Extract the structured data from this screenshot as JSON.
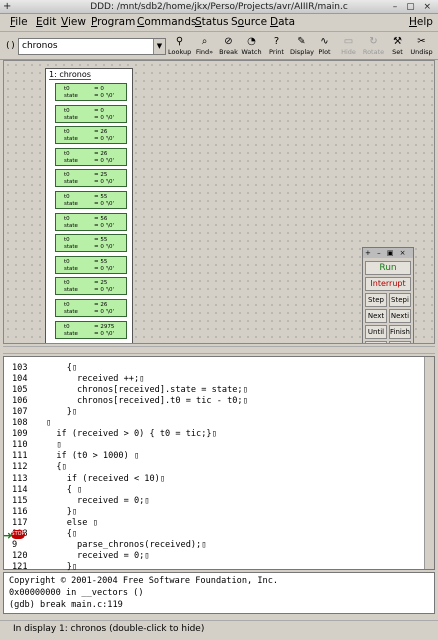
{
  "window": {
    "title": "DDD: /mnt/sdb2/home/jkx/Perso/Projects/avr/AIIIR/main.c"
  },
  "menu": [
    {
      "label": "File",
      "ul": "F"
    },
    {
      "label": "Edit",
      "ul": "E"
    },
    {
      "label": "View",
      "ul": "V"
    },
    {
      "label": "Program",
      "ul": "P"
    },
    {
      "label": "Commands",
      "ul": "C"
    },
    {
      "label": "Status",
      "ul": "S"
    },
    {
      "label": "Source",
      "ul": "o"
    },
    {
      "label": "Data",
      "ul": "D"
    },
    {
      "label": "Help",
      "ul": "H"
    }
  ],
  "toolbar": {
    "arg_label": "():",
    "arg_value": "chronos",
    "buttons": [
      {
        "label": "Lookup",
        "icon": "lookup-icon",
        "glyph": "⚲"
      },
      {
        "label": "Find»",
        "icon": "find-icon",
        "glyph": "⌕"
      },
      {
        "label": "Break",
        "icon": "break-icon",
        "glyph": "⊘"
      },
      {
        "label": "Watch",
        "icon": "watch-icon",
        "glyph": "◔"
      },
      {
        "label": "Print",
        "icon": "print-icon",
        "glyph": "?"
      },
      {
        "label": "Display",
        "icon": "display-icon",
        "glyph": "✎"
      },
      {
        "label": "Plot",
        "icon": "plot-icon",
        "glyph": "∿"
      },
      {
        "label": "Hide",
        "icon": "hide-icon",
        "glyph": "▭",
        "disabled": true
      },
      {
        "label": "Rotate",
        "icon": "rotate-icon",
        "glyph": "↻",
        "disabled": true
      },
      {
        "label": "Set",
        "icon": "set-icon",
        "glyph": "⚒"
      },
      {
        "label": "Undisp",
        "icon": "undisp-icon",
        "glyph": "✂"
      }
    ]
  },
  "display": {
    "title": "1: chronos",
    "rows": [
      {
        "t0": "= 0",
        "state": "= 0 '\\0'"
      },
      {
        "t0": "= 0",
        "state": "= 0 '\\0'"
      },
      {
        "t0": "= 26",
        "state": "= 0 '\\0'"
      },
      {
        "t0": "= 26",
        "state": "= 0 '\\0'"
      },
      {
        "t0": "= 25",
        "state": "= 0 '\\0'"
      },
      {
        "t0": "= 55",
        "state": "= 0 '\\0'"
      },
      {
        "t0": "= 56",
        "state": "= 0 '\\0'"
      },
      {
        "t0": "= 55",
        "state": "= 0 '\\0'"
      },
      {
        "t0": "= 55",
        "state": "= 0 '\\0'"
      },
      {
        "t0": "= 25",
        "state": "= 0 '\\0'"
      },
      {
        "t0": "= 26",
        "state": "= 0 '\\0'"
      },
      {
        "t0": "= 2975",
        "state": "= 0 '\\0'"
      }
    ],
    "field1": "t0",
    "field2": "state"
  },
  "command_tool": {
    "run": "Run",
    "interrupt": "Interrupt",
    "run_color": "#1a7a1a",
    "interrupt_color": "#b00000",
    "buttons": [
      [
        "Step",
        "Stepi"
      ],
      [
        "Next",
        "Nexti"
      ],
      [
        "Until",
        "Finish"
      ],
      [
        "Cont",
        "Kill"
      ],
      [
        "Up",
        "Down"
      ],
      [
        "Undo",
        "Redo"
      ],
      [
        "Edit",
        "Make"
      ]
    ]
  },
  "source": {
    "lines": [
      {
        "n": "103",
        "code": "    {▯"
      },
      {
        "n": "104",
        "code": "      received ++;▯"
      },
      {
        "n": "105",
        "code": "      chronos[received].state = state;▯"
      },
      {
        "n": "106",
        "code": "      chronos[received].t0 = tic - t0;▯"
      },
      {
        "n": "107",
        "code": "    }▯"
      },
      {
        "n": "108",
        "code": "▯"
      },
      {
        "n": "109",
        "code": "  if (received > 0) { t0 = tic;}▯"
      },
      {
        "n": "110",
        "code": "  ▯"
      },
      {
        "n": "111",
        "code": "  if (t0 > 1000) ▯"
      },
      {
        "n": "112",
        "code": "  {▯"
      },
      {
        "n": "113",
        "code": "    if (received < 10)▯"
      },
      {
        "n": "114",
        "code": "    { ▯"
      },
      {
        "n": "115",
        "code": "      received = 0;▯"
      },
      {
        "n": "116",
        "code": "    }▯"
      },
      {
        "n": "117",
        "code": "    else ▯"
      },
      {
        "n": "118",
        "code": "    {▯"
      },
      {
        "n": "9",
        "code": "      parse_chronos(received);▯"
      },
      {
        "n": "120",
        "code": "      received = 0;▯"
      },
      {
        "n": "121",
        "code": "    }▯"
      }
    ],
    "breakpoint_label": "STOP"
  },
  "console": {
    "lines": [
      "Copyright © 2001-2004 Free Software Foundation, Inc.",
      "0x00000000 in __vectors ()",
      "(gdb) break main.c:119"
    ]
  },
  "status": "In display 1: chronos (double-click to hide)"
}
